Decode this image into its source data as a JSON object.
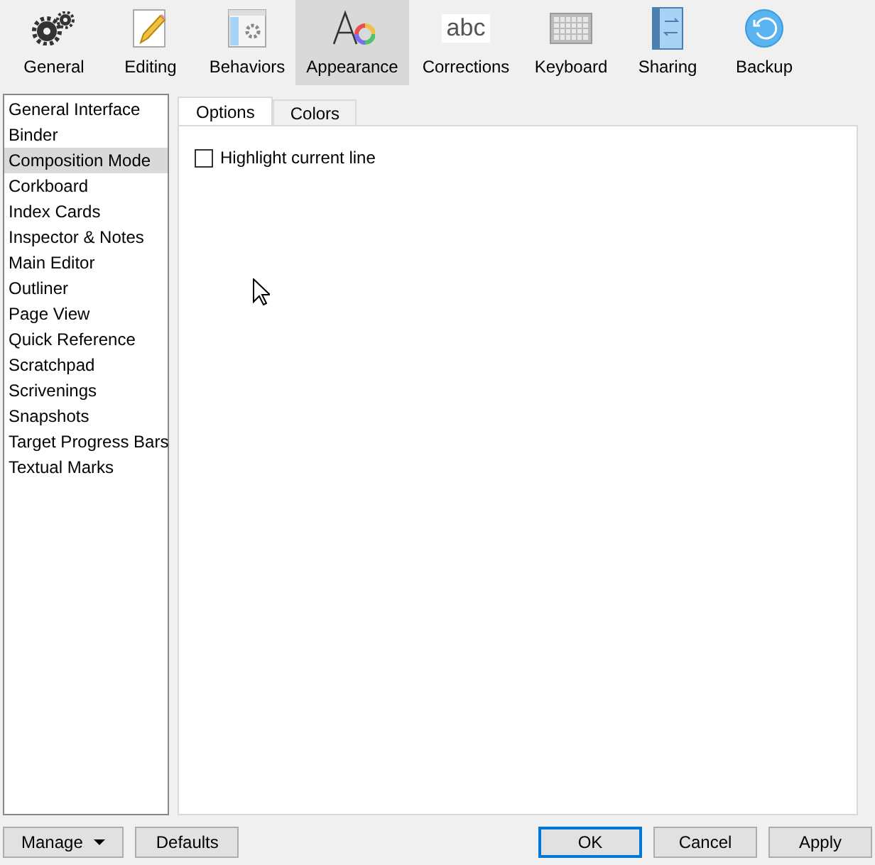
{
  "toolbar": [
    {
      "label": "General",
      "selected": false
    },
    {
      "label": "Editing",
      "selected": false
    },
    {
      "label": "Behaviors",
      "selected": false
    },
    {
      "label": "Appearance",
      "selected": true
    },
    {
      "label": "Corrections",
      "selected": false,
      "icon_text": "abc"
    },
    {
      "label": "Keyboard",
      "selected": false
    },
    {
      "label": "Sharing",
      "selected": false
    },
    {
      "label": "Backup",
      "selected": false
    }
  ],
  "sidebar": {
    "items": [
      {
        "label": "General Interface",
        "selected": false
      },
      {
        "label": "Binder",
        "selected": false
      },
      {
        "label": "Composition Mode",
        "selected": true
      },
      {
        "label": "Corkboard",
        "selected": false
      },
      {
        "label": "Index Cards",
        "selected": false
      },
      {
        "label": "Inspector & Notes",
        "selected": false
      },
      {
        "label": "Main Editor",
        "selected": false
      },
      {
        "label": "Outliner",
        "selected": false
      },
      {
        "label": "Page View",
        "selected": false
      },
      {
        "label": "Quick Reference",
        "selected": false
      },
      {
        "label": "Scratchpad",
        "selected": false
      },
      {
        "label": "Scrivenings",
        "selected": false
      },
      {
        "label": "Snapshots",
        "selected": false
      },
      {
        "label": "Target Progress Bars",
        "selected": false
      },
      {
        "label": "Textual Marks",
        "selected": false
      }
    ]
  },
  "tabs": [
    {
      "label": "Options",
      "selected": true
    },
    {
      "label": "Colors",
      "selected": false
    }
  ],
  "options": [
    {
      "label": "Highlight current line",
      "checked": false
    }
  ],
  "buttons_left": [
    {
      "label": "Manage",
      "kind": "dropdown"
    },
    {
      "label": "Defaults",
      "kind": "plain"
    }
  ],
  "buttons_right": [
    {
      "label": "OK",
      "default": true
    },
    {
      "label": "Cancel",
      "default": false
    },
    {
      "label": "Apply",
      "default": false
    }
  ]
}
